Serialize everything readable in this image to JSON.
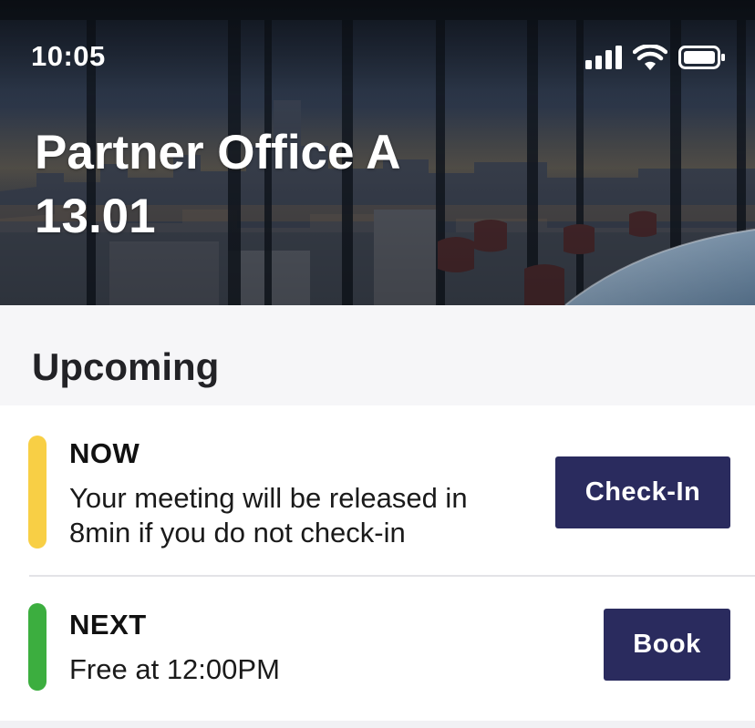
{
  "status_bar": {
    "time": "10:05",
    "icons": [
      "cellular-signal-icon",
      "wifi-icon",
      "battery-icon"
    ]
  },
  "hero": {
    "title_line1": "Partner Office A",
    "title_line2": "13.01"
  },
  "section": {
    "title": "Upcoming"
  },
  "items": [
    {
      "label": "NOW",
      "description": "Your meeting will be released in 8min if you do not check-in",
      "indicator_color": "#f8cf45",
      "button_label": "Check-In"
    },
    {
      "label": "NEXT",
      "description": "Free at 12:00PM",
      "indicator_color": "#3cae3f",
      "button_label": "Book"
    }
  ],
  "colors": {
    "button_bg": "#2a2b5e",
    "button_text": "#ffffff",
    "section_bg": "#f6f6f8"
  }
}
